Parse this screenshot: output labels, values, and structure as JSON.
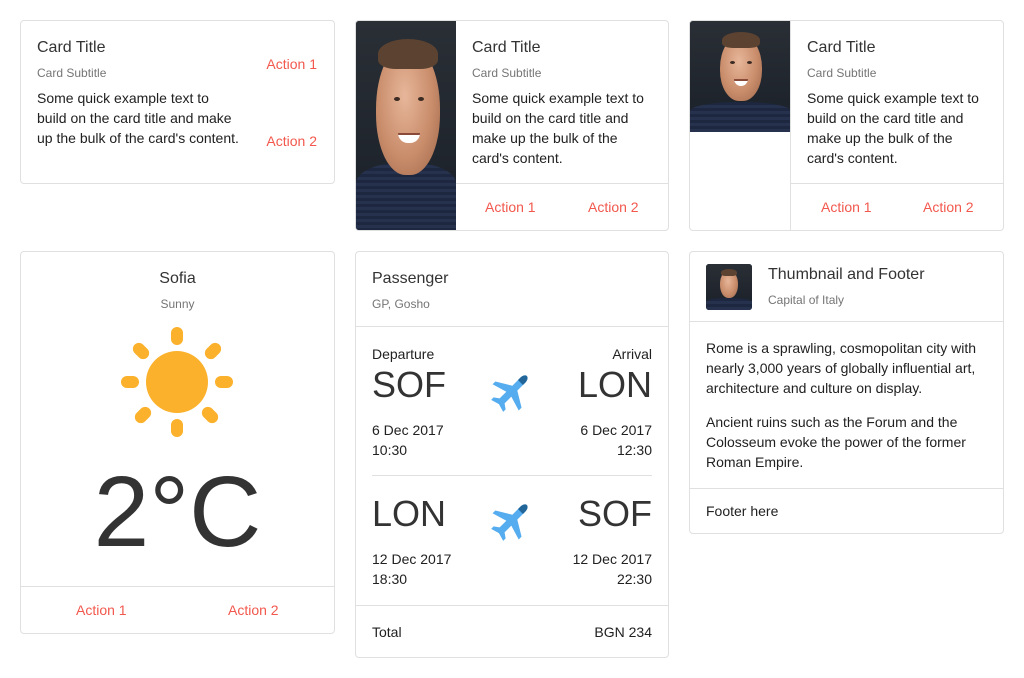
{
  "colors": {
    "accent": "#f2584d",
    "sun": "#fbb12b",
    "border": "#e0e0e0"
  },
  "card1": {
    "title": "Card Title",
    "subtitle": "Card Subtitle",
    "text": "Some quick example text to build on the card title and make up the bulk of the card's content.",
    "action1": "Action 1",
    "action2": "Action 2"
  },
  "card2": {
    "title": "Card Title",
    "subtitle": "Card Subtitle",
    "text": "Some quick example text to build on the card title and make up the bulk of the card's content.",
    "action1": "Action 1",
    "action2": "Action 2"
  },
  "card3": {
    "title": "Card Title",
    "subtitle": "Card Subtitle",
    "text": "Some quick example text to build on the card title and make up the bulk of the card's content.",
    "action1": "Action 1",
    "action2": "Action 2"
  },
  "weather": {
    "city": "Sofia",
    "condition": "Sunny",
    "icon": "sun-icon",
    "temperature": "2°C",
    "action1": "Action 1",
    "action2": "Action 2"
  },
  "flight": {
    "title": "Passenger",
    "subtitle": "GP, Gosho",
    "departure_label": "Departure",
    "arrival_label": "Arrival",
    "plane_icon": "airplane-icon",
    "legs": [
      {
        "from": "SOF",
        "to": "LON",
        "dep_date": "6 Dec 2017",
        "dep_time": "10:30",
        "arr_date": "6 Dec 2017",
        "arr_time": "12:30"
      },
      {
        "from": "LON",
        "to": "SOF",
        "dep_date": "12 Dec 2017",
        "dep_time": "18:30",
        "arr_date": "12 Dec 2017",
        "arr_time": "22:30"
      }
    ],
    "total_label": "Total",
    "total_value": "BGN 234"
  },
  "thumb": {
    "title": "Thumbnail and Footer",
    "subtitle": "Capital of Italy",
    "paragraph1": "Rome is a sprawling, cosmopolitan city with nearly 3,000 years of globally influential art, architecture and culture on display.",
    "paragraph2": "Ancient ruins such as the Forum and the Colosseum evoke the power of the former Roman Empire.",
    "footer": "Footer here"
  }
}
